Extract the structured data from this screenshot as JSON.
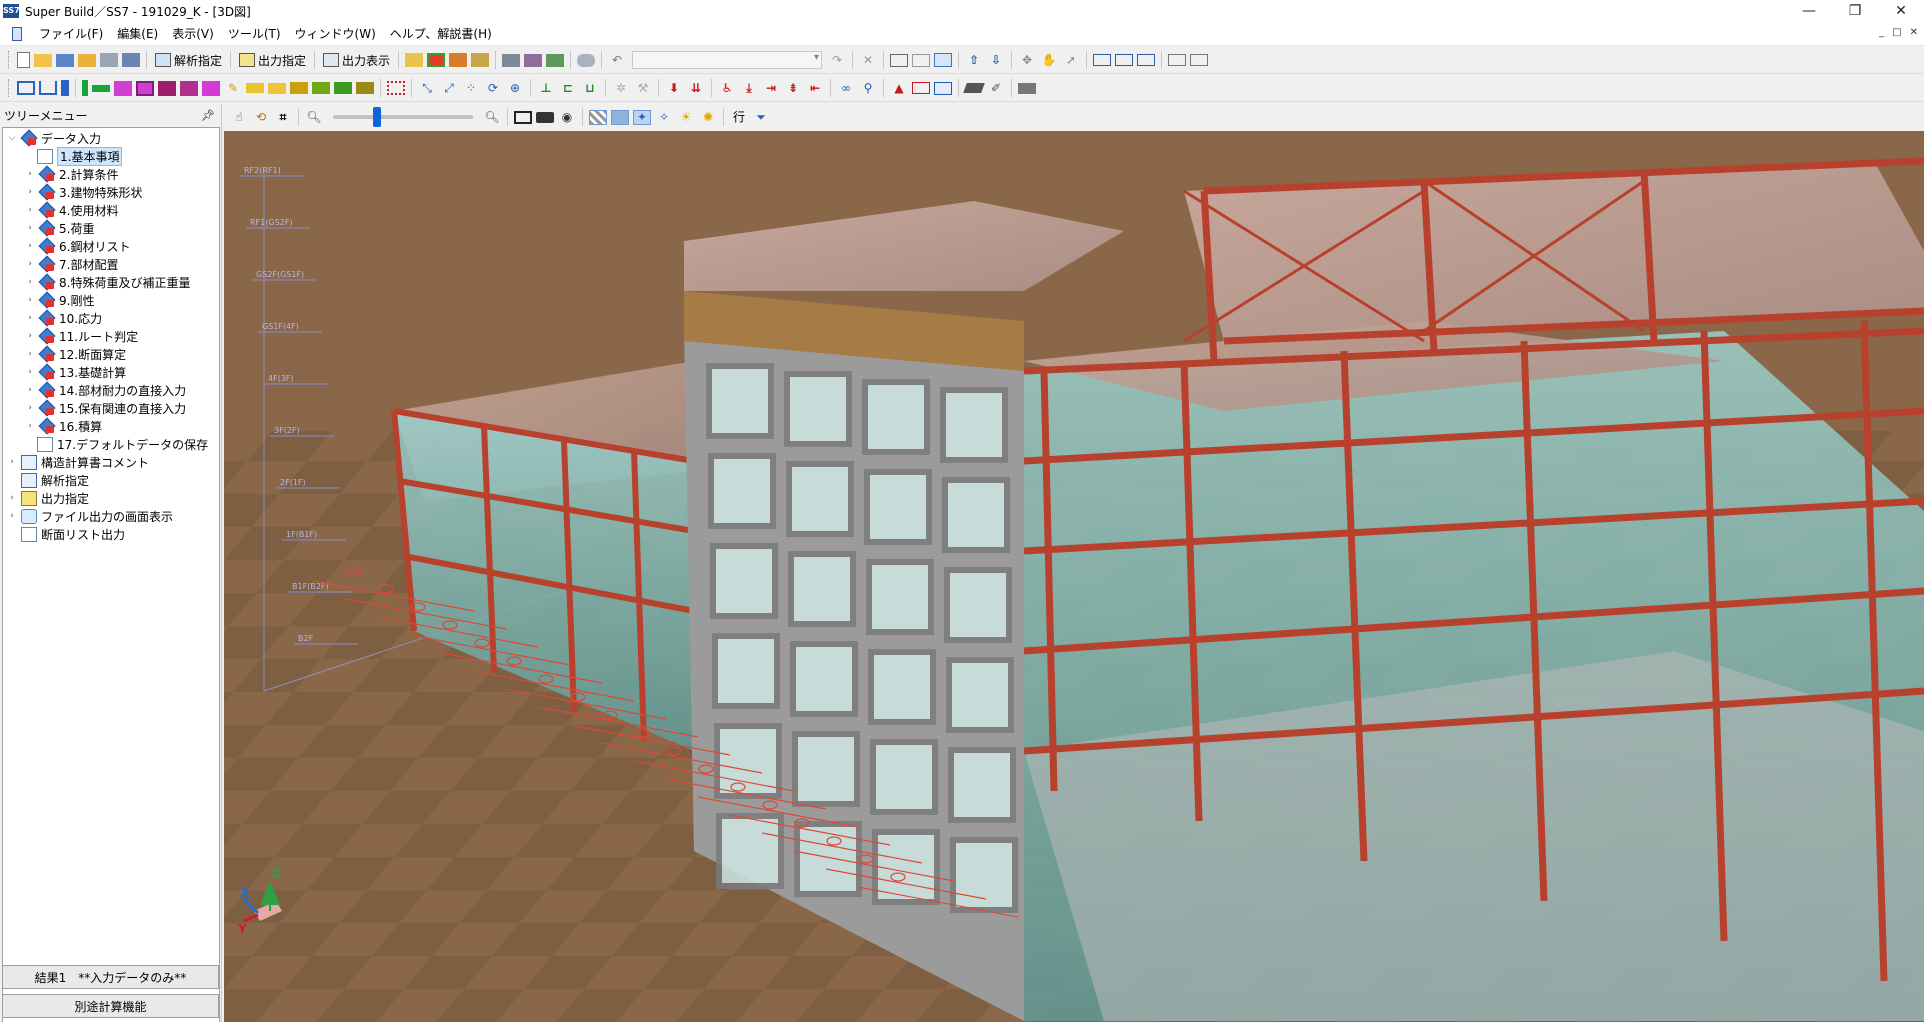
{
  "window": {
    "title": "Super Build／SS7 - 191029_K - [3D図]",
    "app_icon_text": "SS7",
    "minimize": "—",
    "maximize": "❐",
    "close": "✕"
  },
  "menu": {
    "items": [
      "ファイル(F)",
      "編集(E)",
      "表示(V)",
      "ツール(T)",
      "ウィンドウ(W)",
      "ヘルプ、解説書(H)"
    ],
    "mdi_controls": [
      "_",
      "□",
      "✕"
    ]
  },
  "toolbar": {
    "analysis_label": "解析指定",
    "output_label": "出力指定",
    "display_label": "出力表示"
  },
  "tree": {
    "header": "ツリーメニュー",
    "pin_icon": "pin-icon",
    "root": "データ入力",
    "items": [
      "1.基本事項",
      "2.計算条件",
      "3.建物特殊形状",
      "4.使用材料",
      "5.荷重",
      "6.鋼材リスト",
      "7.部材配置",
      "8.特殊荷重及び補正重量",
      "9.剛性",
      "10.応力",
      "11.ルート判定",
      "12.断面算定",
      "13.基礎計算",
      "14.部材耐力の直接入力",
      "15.保有関連の直接入力",
      "16.積算",
      "17.デフォルトデータの保存"
    ],
    "top_items": [
      "構造計算書コメント",
      "解析指定",
      "出力指定",
      "ファイル出力の画面表示",
      "断面リスト出力"
    ]
  },
  "panel_buttons": {
    "result": "結果1　**入力データのみ**",
    "separate_calc": "別途計算機能"
  },
  "view": {
    "slider_zoom": 0.3,
    "gyo_char": "行",
    "colors": {
      "ground": "#8a6748",
      "ground_dark": "#6f5038",
      "steel": "#b8412e",
      "glass": "#8ec3c0",
      "concrete": "#9b9b9b",
      "wood": "#a67b45"
    },
    "level_labels": [
      "RF2(RF1)",
      "RF1(GS2F)",
      "GS2F(GS1F)",
      "GS1F(4F)",
      "4F(3F)",
      "3F(2F)",
      "2F(1F)",
      "1F(B1F)",
      "B1F(B2F)",
      "B2F"
    ],
    "axis_labels": {
      "z": "Z",
      "x": "X",
      "y": "Y"
    }
  }
}
